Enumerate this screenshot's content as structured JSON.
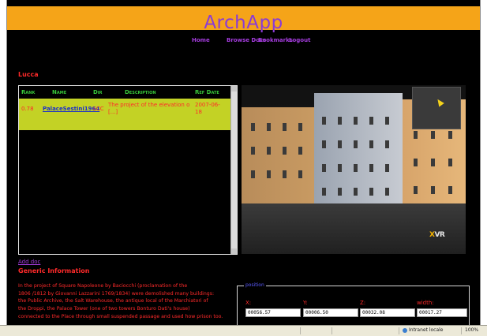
{
  "app": {
    "title": "ArchApp"
  },
  "nav": {
    "home": "Home",
    "browse": "Browse Docs",
    "bookmarks": "Bookmarks",
    "logout": "Logout"
  },
  "city": "Lucca",
  "results": {
    "headers": {
      "rank": "Rank",
      "name": "Name",
      "dir": "Dir",
      "description": "Description",
      "refdate": "Ref Date"
    },
    "row": {
      "rank": "0.78",
      "name": "PalaceSestini1964",
      "dir": "LCC",
      "description_1": "The project of the elevation o",
      "description_2": "[...]",
      "refdate_1": "2007-06-",
      "refdate_2": "18"
    }
  },
  "add_doc": "Add doc",
  "generic": {
    "heading": "Generic Information",
    "lines": [
      "In the project of Square Napoleone by Baciocchi (proclamation of the",
      "1806 /1812 by Giovanni Lazzarini 1769/1834) were demolished many buildings:",
      "the Public Archive, the Salt Warehouse, the antique local of the Marchiatori of",
      "the Droppi, the Palace Tower (one of two towers Bonturo Dati's house)",
      "connected to the Place through small suspended passage and used how prison too."
    ]
  },
  "position": {
    "legend": "position",
    "x_label": "X:",
    "y_label": "Y:",
    "z_label": "Z:",
    "w_label": "width:",
    "x": "00056.57",
    "y": "00006.50",
    "z": "00032.08",
    "w": "00017.27"
  },
  "viewer": {
    "logo_x": "X",
    "logo_vr": "VR"
  },
  "status": {
    "zone": "Intranet locale",
    "zoom": "100%"
  }
}
